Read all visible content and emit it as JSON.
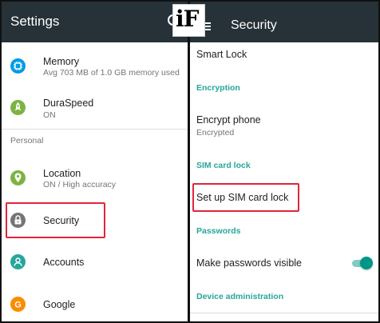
{
  "logo": {
    "text": "iF"
  },
  "left_panel": {
    "title": "Settings",
    "items": [
      {
        "label": "Memory",
        "sublabel": "Avg 703 MB of 1.0 GB memory used",
        "icon": "memory-icon",
        "icon_color": "#039be5"
      },
      {
        "label": "DuraSpeed",
        "sublabel": "ON",
        "icon": "rocket-icon",
        "icon_color": "#7cb342"
      }
    ],
    "section_personal": "Personal",
    "personal_items": [
      {
        "label": "Location",
        "sublabel": "ON / High accuracy",
        "icon": "location-icon",
        "icon_color": "#7cb342"
      },
      {
        "label": "Security",
        "icon": "lock-icon",
        "icon_color": "#757575",
        "highlighted": true
      },
      {
        "label": "Accounts",
        "icon": "account-icon",
        "icon_color": "#26a69a"
      },
      {
        "label": "Google",
        "icon": "google-icon",
        "icon_color": "#fb8c00"
      }
    ]
  },
  "right_panel": {
    "title": "Security",
    "smart_lock": "Smart Lock",
    "encryption_header": "Encryption",
    "encrypt_phone": {
      "label": "Encrypt phone",
      "sublabel": "Encrypted"
    },
    "sim_header": "SIM card lock",
    "set_up_sim": "Set up SIM card lock",
    "passwords_header": "Passwords",
    "make_passwords_visible": {
      "label": "Make passwords visible",
      "enabled": true
    },
    "device_admin_header": "Device administration"
  },
  "colors": {
    "appbar": "#263238",
    "accent": "#26a69a",
    "highlight_box": "#e0263a",
    "toggle_on": "#009688"
  }
}
